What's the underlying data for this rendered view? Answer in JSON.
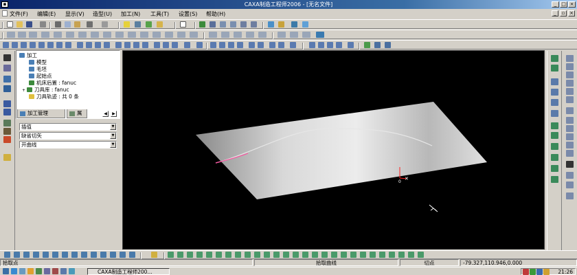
{
  "window": {
    "title": "CAXA制造工程师2006 - [无名文件]",
    "app_icon": "window-icon"
  },
  "menu": {
    "items": [
      "文件(F)",
      "编辑(E)",
      "显示(V)",
      "造型(U)",
      "加工(N)",
      "工具(T)",
      "设置(S)",
      "帮助(H)"
    ]
  },
  "tree": {
    "root": "加工",
    "items": [
      {
        "label": "模型",
        "icon": "model-icon",
        "color": "#4a7fb5"
      },
      {
        "label": "毛坯",
        "icon": "blank-icon",
        "color": "#4a7fb5"
      },
      {
        "label": "起始点",
        "icon": "start-point-icon",
        "color": "#4a7fb5"
      },
      {
        "label": "机床后置 : fanuc",
        "icon": "machine-post-icon",
        "color": "#3d8a3d"
      },
      {
        "label": "刀具库 : fanuc",
        "icon": "tool-library-icon",
        "color": "#3d8a3d"
      },
      {
        "label": "刀具轨迹 : 共 0 条",
        "icon": "folder-icon",
        "color": "#e0c040"
      }
    ]
  },
  "tabs": {
    "active": "加工管理",
    "second": "属"
  },
  "properties": [
    "插值",
    "缺省切矢",
    "开曲线"
  ],
  "viewport": {
    "axis_label": "0"
  },
  "status": {
    "left": "拾取点",
    "middle": "拾取曲线",
    "mode": "切点",
    "coords": "-79.327,110.946,0.000"
  },
  "taskbar": {
    "task": "CAXA制造工程师200...",
    "clock": "21:26"
  },
  "colors": {
    "title_start": "#0a246a",
    "title_end": "#a6caf0",
    "viewport_bg": "#000000",
    "surface_light": "#e8e8e8",
    "curve": "#e6e6e6",
    "curve_highlight": "#ff4fa0",
    "axis_red": "#ff2020"
  }
}
